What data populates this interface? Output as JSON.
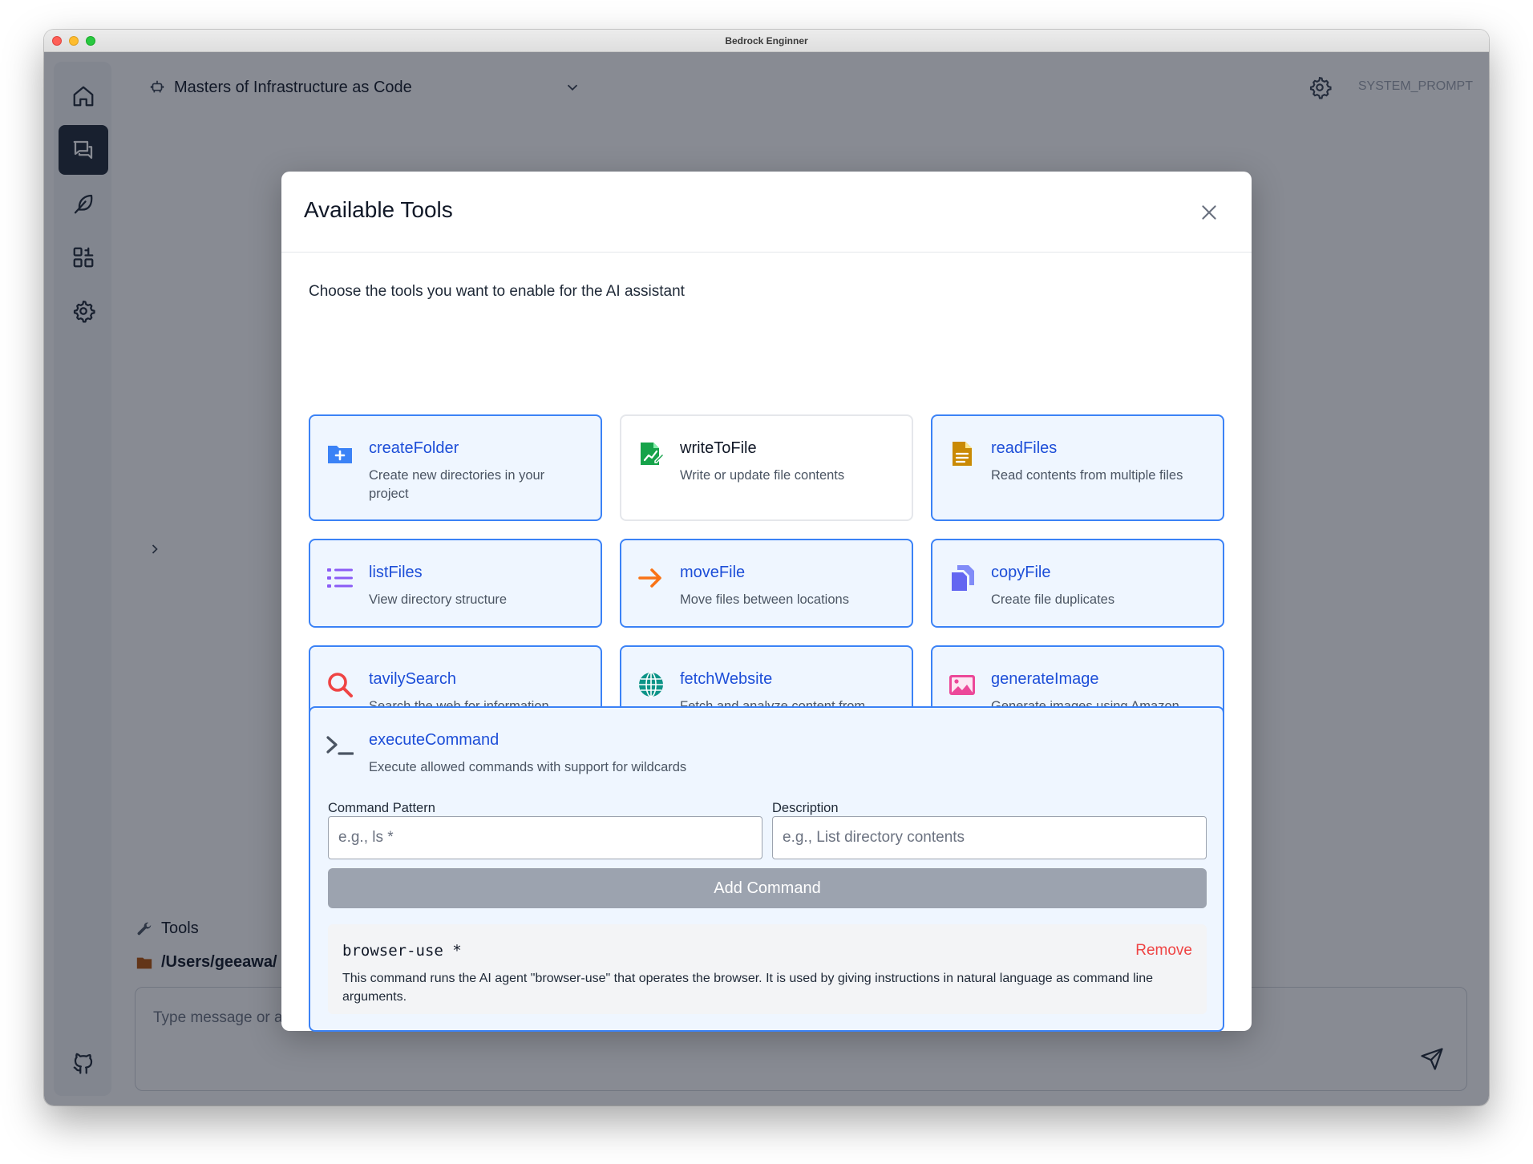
{
  "window": {
    "title": "Bedrock Enginner"
  },
  "sidebar": {
    "items": [
      {
        "name": "home",
        "icon": "home-icon",
        "active": false
      },
      {
        "name": "chat",
        "icon": "chat-icon",
        "active": true
      },
      {
        "name": "feather",
        "icon": "feather-icon",
        "active": false
      },
      {
        "name": "apps",
        "icon": "apps-icon",
        "active": false
      },
      {
        "name": "settings",
        "icon": "gear-icon",
        "active": false
      }
    ],
    "footer_icon": "github-icon"
  },
  "header": {
    "agent_name": "Masters of Infrastructure as Code",
    "system_prompt_label": "SYSTEM_PROMPT"
  },
  "bottom": {
    "tools_label": "Tools",
    "path_label": "/Users/geeawa/",
    "input_placeholder": "Type message or add images (⌘+V / drop)"
  },
  "modal": {
    "title": "Available Tools",
    "intro": "Choose the tools you want to enable for the AI assistant",
    "tools": [
      {
        "name": "createFolder",
        "description": "Create new directories in your project",
        "enabled": true,
        "icon": "folder-plus-icon",
        "icon_color": "#3b82f6"
      },
      {
        "name": "writeToFile",
        "description": "Write or update file contents",
        "enabled": false,
        "icon": "file-edit-icon",
        "icon_color": "#16a34a"
      },
      {
        "name": "readFiles",
        "description": "Read contents from multiple files",
        "enabled": true,
        "icon": "file-text-icon",
        "icon_color": "#ca8a04"
      },
      {
        "name": "listFiles",
        "description": "View directory structure",
        "enabled": true,
        "icon": "list-icon",
        "icon_color": "#8b5cf6"
      },
      {
        "name": "moveFile",
        "description": "Move files between locations",
        "enabled": true,
        "icon": "arrow-right-icon",
        "icon_color": "#f97316"
      },
      {
        "name": "copyFile",
        "description": "Create file duplicates",
        "enabled": true,
        "icon": "copy-icon",
        "icon_color": "#6366f1"
      },
      {
        "name": "tavilySearch",
        "description": "Search the web for information",
        "enabled": true,
        "icon": "search-icon",
        "icon_color": "#ef4444"
      },
      {
        "name": "fetchWebsite",
        "description": "Fetch and analyze content from websites",
        "enabled": true,
        "icon": "globe-icon",
        "icon_color": "#0d9488"
      },
      {
        "name": "generateImage",
        "description": "Generate images using Amazon Bedrock Stable Diffusion models",
        "enabled": true,
        "icon": "image-icon",
        "icon_color": "#ec4899"
      }
    ],
    "execute_command": {
      "name": "executeCommand",
      "description": "Execute allowed commands with support for wildcards",
      "icon": "terminal-icon",
      "pattern_label": "Command Pattern",
      "pattern_placeholder": "e.g., ls *",
      "description_label": "Description",
      "description_placeholder": "e.g., List directory contents",
      "add_button": "Add Command",
      "commands": [
        {
          "pattern": "browser-use *",
          "description": "This command runs the AI agent \"browser-use\" that operates the browser. It is used by giving instructions in natural language as command line arguments.",
          "remove_label": "Remove"
        }
      ]
    }
  },
  "colors": {
    "accent": "#3b82f6",
    "card_bg": "#eff6ff",
    "danger": "#ef4444",
    "button_disabled": "#9ca3af"
  }
}
